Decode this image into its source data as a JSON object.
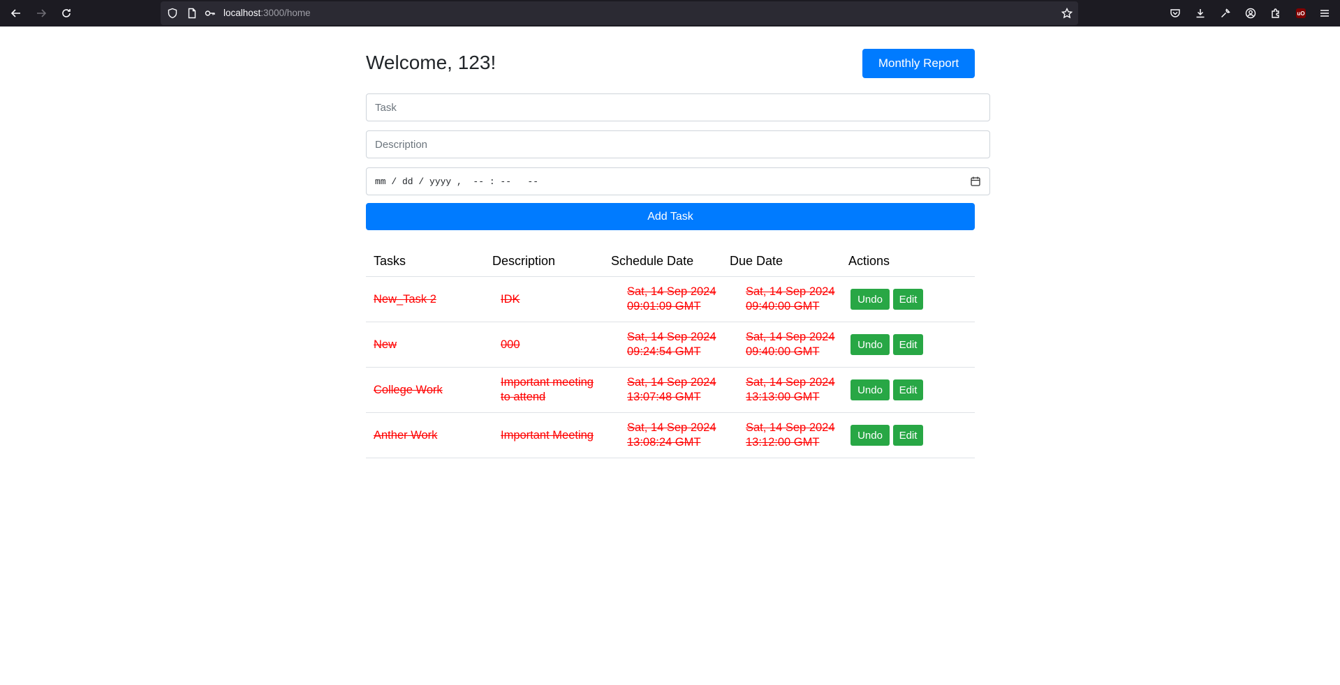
{
  "browser": {
    "url_host": "localhost",
    "url_path": ":3000/home",
    "ublock_label": "uO"
  },
  "header": {
    "welcome": "Welcome, 123!",
    "report_button": "Monthly Report"
  },
  "form": {
    "task_placeholder": "Task",
    "description_placeholder": "Description",
    "datetime_placeholder": "mm / dd / yyyy ,  -- : --   --",
    "add_button": "Add Task"
  },
  "table": {
    "headers": [
      "Tasks",
      "Description",
      "Schedule Date",
      "Due Date",
      "Actions"
    ],
    "rows": [
      {
        "task": "New_Task 2",
        "description": "IDK",
        "schedule": "Sat, 14 Sep 2024 09:01:09 GMT",
        "due": "Sat, 14 Sep 2024 09:40:00 GMT",
        "undo": "Undo",
        "edit": "Edit"
      },
      {
        "task": "New",
        "description": "000",
        "schedule": "Sat, 14 Sep 2024 09:24:54 GMT",
        "due": "Sat, 14 Sep 2024 09:40:00 GMT",
        "undo": "Undo",
        "edit": "Edit"
      },
      {
        "task": "College Work",
        "description": "Important meeting to attend",
        "schedule": "Sat, 14 Sep 2024 13:07:48 GMT",
        "due": "Sat, 14 Sep 2024 13:13:00 GMT",
        "undo": "Undo",
        "edit": "Edit"
      },
      {
        "task": "Anther Work",
        "description": "Important Meeting",
        "schedule": "Sat, 14 Sep 2024 13:08:24 GMT",
        "due": "Sat, 14 Sep 2024 13:12:00 GMT",
        "undo": "Undo",
        "edit": "Edit"
      }
    ]
  },
  "colors": {
    "primary": "#007bff",
    "success": "#28a745",
    "completed_text": "#ff0000"
  }
}
